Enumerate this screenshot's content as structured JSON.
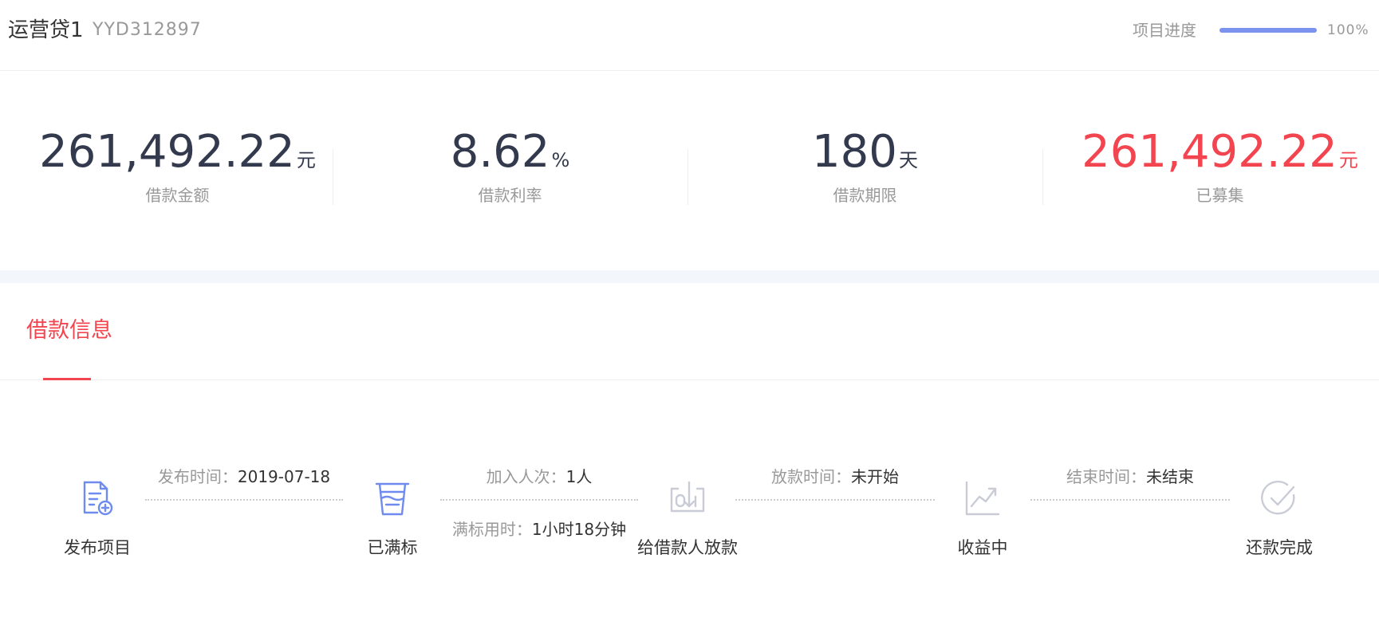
{
  "header": {
    "title": "运营贷1",
    "code": "YYD312897",
    "progress_label": "项目进度",
    "progress_value": 100,
    "progress_text": "100%"
  },
  "stats": [
    {
      "value": "261,492.22",
      "unit": "元",
      "label": "借款金额"
    },
    {
      "value": "8.62",
      "unit": "%",
      "label": "借款利率"
    },
    {
      "value": "180",
      "unit": "天",
      "label": "借款期限"
    },
    {
      "value": "261,492.22",
      "unit": "元",
      "label": "已募集"
    }
  ],
  "tabs": [
    {
      "label": "借款信息"
    }
  ],
  "timeline": {
    "steps": [
      {
        "label": "发布项目",
        "icon": "document-add-icon",
        "active": true
      },
      {
        "label": "已满标",
        "icon": "cup-icon",
        "active": true
      },
      {
        "label": "给借款人放款",
        "icon": "loan-release-icon",
        "active": false
      },
      {
        "label": "收益中",
        "icon": "earnings-chart-icon",
        "active": false
      },
      {
        "label": "还款完成",
        "icon": "check-circle-icon",
        "active": false
      }
    ],
    "meta": {
      "publish_time_label": "发布时间：",
      "publish_time_value": "2019-07-18",
      "join_count_label": "加入人次：",
      "join_count_value": "1人",
      "full_time_label": "满标用时：",
      "full_time_value": "1小时18分钟",
      "loan_time_label": "放款时间：",
      "loan_time_value": "未开始",
      "end_time_label": "结束时间：",
      "end_time_value": "未结束"
    }
  },
  "colors": {
    "accent_red": "#f2454f",
    "progress_blue": "#7c92ef",
    "active_icon": "#6f8bf0",
    "inactive_icon": "#c9ccd6"
  }
}
